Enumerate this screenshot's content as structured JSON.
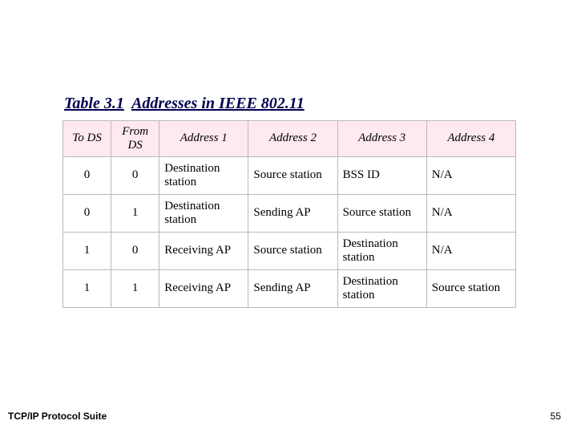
{
  "caption": {
    "tablekey": "Table 3.1",
    "title": "Addresses in IEEE 802.11"
  },
  "table": {
    "headers": {
      "to_ds": "To DS",
      "from_ds": "From DS",
      "addr1": "Address 1",
      "addr2": "Address 2",
      "addr3": "Address 3",
      "addr4": "Address 4"
    },
    "rows": [
      {
        "to_ds": "0",
        "from_ds": "0",
        "addr1": "Destination station",
        "addr2": "Source station",
        "addr3": "BSS ID",
        "addr4": "N/A"
      },
      {
        "to_ds": "0",
        "from_ds": "1",
        "addr1": "Destination station",
        "addr2": "Sending AP",
        "addr3": "Source station",
        "addr4": "N/A"
      },
      {
        "to_ds": "1",
        "from_ds": "0",
        "addr1": "Receiving AP",
        "addr2": "Source station",
        "addr3": "Destination station",
        "addr4": "N/A"
      },
      {
        "to_ds": "1",
        "from_ds": "1",
        "addr1": "Receiving AP",
        "addr2": "Sending AP",
        "addr3": "Destination station",
        "addr4": "Source station"
      }
    ]
  },
  "footer": {
    "left": "TCP/IP Protocol Suite",
    "right": "55"
  },
  "chart_data": {
    "type": "table",
    "title": "Table 3.1  Addresses in IEEE 802.11",
    "columns": [
      "To DS",
      "From DS",
      "Address 1",
      "Address 2",
      "Address 3",
      "Address 4"
    ],
    "rows": [
      [
        "0",
        "0",
        "Destination station",
        "Source station",
        "BSS ID",
        "N/A"
      ],
      [
        "0",
        "1",
        "Destination station",
        "Sending AP",
        "Source station",
        "N/A"
      ],
      [
        "1",
        "0",
        "Receiving AP",
        "Source station",
        "Destination station",
        "N/A"
      ],
      [
        "1",
        "1",
        "Receiving AP",
        "Sending AP",
        "Destination station",
        "Source station"
      ]
    ]
  }
}
